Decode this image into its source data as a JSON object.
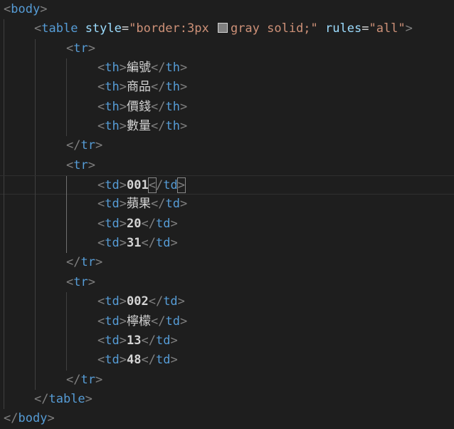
{
  "code": {
    "body_open": {
      "tag": "body"
    },
    "table_open": {
      "tag": "table",
      "attr1_name": "style",
      "attr1_value_before_swatch": "\"border:3px ",
      "attr1_value_after_swatch": "gray solid;\"",
      "attr2_name": "rules",
      "attr2_value": "\"all\"",
      "swatch_color": "#808080"
    },
    "rows": [
      {
        "tag": "tr",
        "cells": [
          {
            "tag": "th",
            "text": "編號"
          },
          {
            "tag": "th",
            "text": "商品"
          },
          {
            "tag": "th",
            "text": "價錢"
          },
          {
            "tag": "th",
            "text": "數量"
          }
        ]
      },
      {
        "tag": "tr",
        "cells": [
          {
            "tag": "td",
            "text": "001"
          },
          {
            "tag": "td",
            "text": "蘋果"
          },
          {
            "tag": "td",
            "text": "20"
          },
          {
            "tag": "td",
            "text": "31"
          }
        ]
      },
      {
        "tag": "tr",
        "cells": [
          {
            "tag": "td",
            "text": "002"
          },
          {
            "tag": "td",
            "text": "檸檬"
          },
          {
            "tag": "td",
            "text": "13"
          },
          {
            "tag": "td",
            "text": "48"
          }
        ]
      }
    ],
    "table_close": {
      "tag": "table"
    },
    "body_close": {
      "tag": "body"
    }
  }
}
